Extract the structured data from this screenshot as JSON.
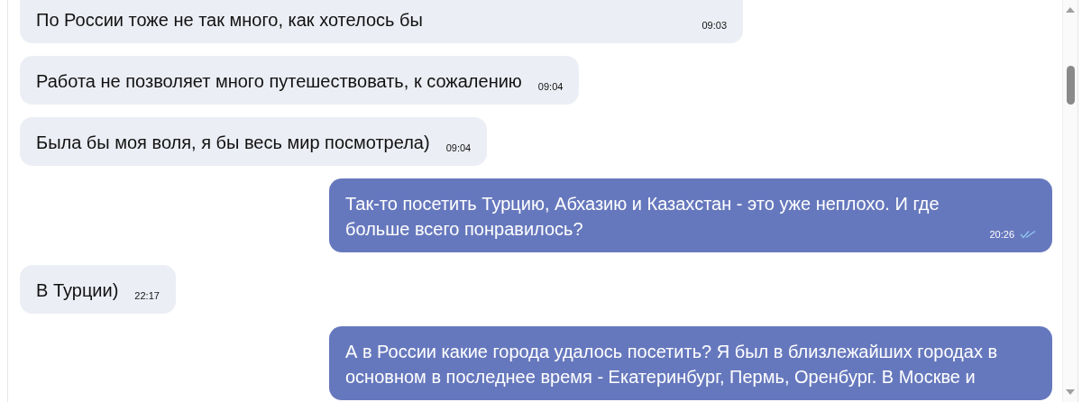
{
  "messages": [
    {
      "kind": "incoming",
      "text": "По России тоже не так много, как хотелось бы",
      "time": "09:03"
    },
    {
      "kind": "incoming",
      "text": "Работа не позволяет много путешествовать, к сожалению",
      "time": "09:04"
    },
    {
      "kind": "incoming",
      "text": "Была бы моя воля, я бы весь мир посмотрела)",
      "time": "09:04"
    },
    {
      "kind": "outgoing",
      "text": "Так-то посетить Турцию, Абхазию и Казахстан - это уже неплохо. И где больше всего понравилось?",
      "time": "20:26",
      "read": true
    },
    {
      "kind": "incoming",
      "text": "В Турции)",
      "time": "22:17"
    },
    {
      "kind": "outgoing",
      "text": "А в России какие города удалось посетить? Я был в близлежайших городах в основном в последнее время - Екатеринбург, Пермь, Оренбург. В Москве и"
    }
  ]
}
